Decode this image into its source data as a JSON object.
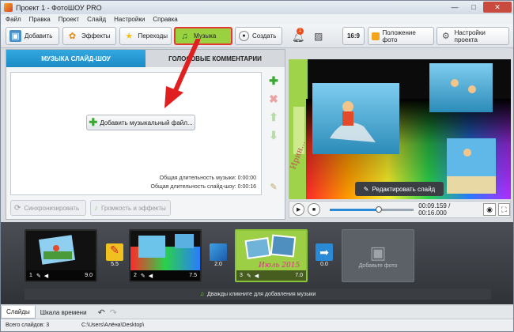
{
  "window": {
    "title": "Проект 1 - ФотоШОУ PRO",
    "minimize": "—",
    "maximize": "□",
    "close": "✕"
  },
  "menu": [
    "Файл",
    "Правка",
    "Проект",
    "Слайд",
    "Настройки",
    "Справка"
  ],
  "toolbar": {
    "add": "Добавить",
    "effects": "Эффекты",
    "transitions": "Переходы",
    "music": "Музыка",
    "create": "Создать",
    "notifications": "1",
    "ratio": "16:9",
    "photo_position": "Положение фото",
    "project_settings": "Настройки проекта"
  },
  "tabs": {
    "music": "МУЗЫКА СЛАЙД-ШОУ",
    "comments": "ГОЛОСОВЫЕ КОММЕНТАРИИ"
  },
  "music": {
    "add_button": "Добавить музыкальный файл...",
    "music_duration": "Общая длительность музыки: 0:00:00",
    "slideshow_duration": "Общая длительность слайд-шоу: 0:00:16",
    "sync": "Синхронизировать",
    "volume": "Громкость и эффекты"
  },
  "preview": {
    "edit_slide": "Редактировать слайд",
    "time": "00:09.159 / 00:16.000",
    "progress": 0.58,
    "annotation": "Ирин..."
  },
  "slides": [
    {
      "num": "1",
      "duration": "9.0"
    },
    {
      "num": "2",
      "duration": "7.5"
    },
    {
      "num": "3",
      "duration": "7.0",
      "caption": "Июль 2015"
    }
  ],
  "transitions": [
    {
      "duration": "5.5"
    },
    {
      "duration": "2.0"
    },
    {
      "duration": "0.0"
    }
  ],
  "add_photo": "Добавьте фото",
  "music_hint": "Дважды кликните для добавления музыки",
  "bottom_tabs": [
    "Слайды",
    "Шкала времени"
  ],
  "status": {
    "count": "Всего слайдов: 3",
    "path": "C:\\Users\\Алёна\\Desktop\\"
  },
  "colors": {
    "accent_blue": "#1d8bc6",
    "music_tab": "#9ad13e",
    "highlight": "#e53935",
    "add_green": "#38a832"
  }
}
